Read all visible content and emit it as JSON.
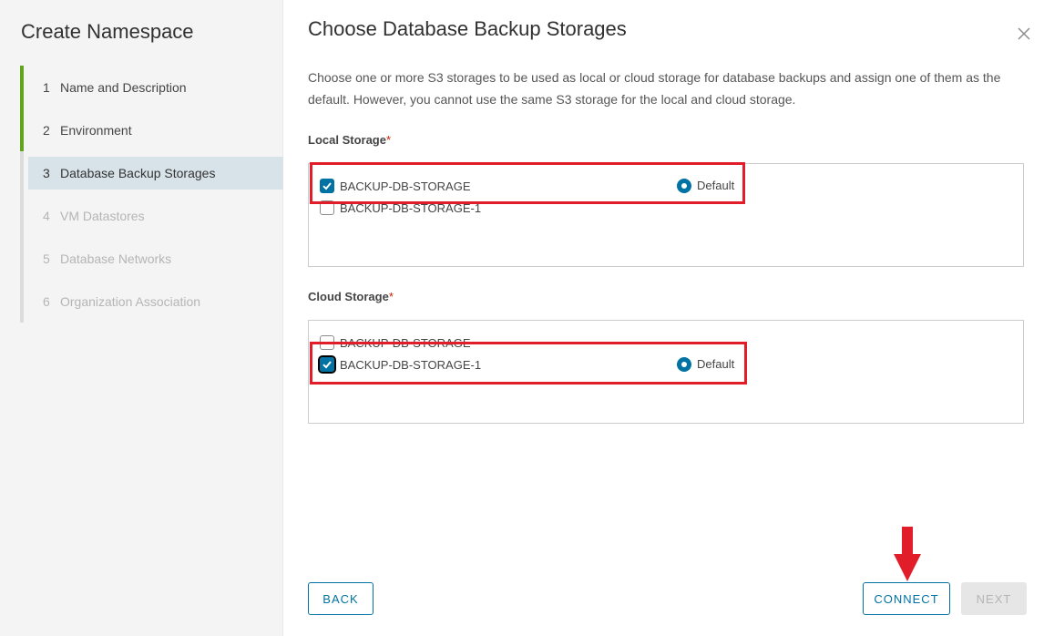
{
  "sidebar": {
    "title": "Create Namespace",
    "steps": [
      {
        "num": "1",
        "label": "Name and Description"
      },
      {
        "num": "2",
        "label": "Environment"
      },
      {
        "num": "3",
        "label": "Database Backup Storages"
      },
      {
        "num": "4",
        "label": "VM Datastores"
      },
      {
        "num": "5",
        "label": "Database Networks"
      },
      {
        "num": "6",
        "label": "Organization Association"
      }
    ]
  },
  "main": {
    "title": "Choose Database Backup Storages",
    "description": "Choose one or more S3 storages to be used as local or cloud storage for database backups and assign one of them as the default. However, you cannot use the same S3 storage for the local and cloud storage.",
    "local": {
      "label": "Local Storage",
      "required_mark": "*",
      "items": [
        {
          "name": "BACKUP-DB-STORAGE",
          "checked": true,
          "default_label": "Default"
        },
        {
          "name": "BACKUP-DB-STORAGE-1",
          "checked": false
        }
      ]
    },
    "cloud": {
      "label": "Cloud Storage",
      "required_mark": "*",
      "items": [
        {
          "name": "BACKUP-DB-STORAGE",
          "checked": false
        },
        {
          "name": "BACKUP-DB-STORAGE-1",
          "checked": true,
          "default_label": "Default"
        }
      ]
    }
  },
  "footer": {
    "back_label": "BACK",
    "connect_label": "CONNECT",
    "next_label": "NEXT"
  },
  "colors": {
    "accent": "#0072a3",
    "done_step": "#62a420",
    "annotation": "#e11d2a"
  }
}
